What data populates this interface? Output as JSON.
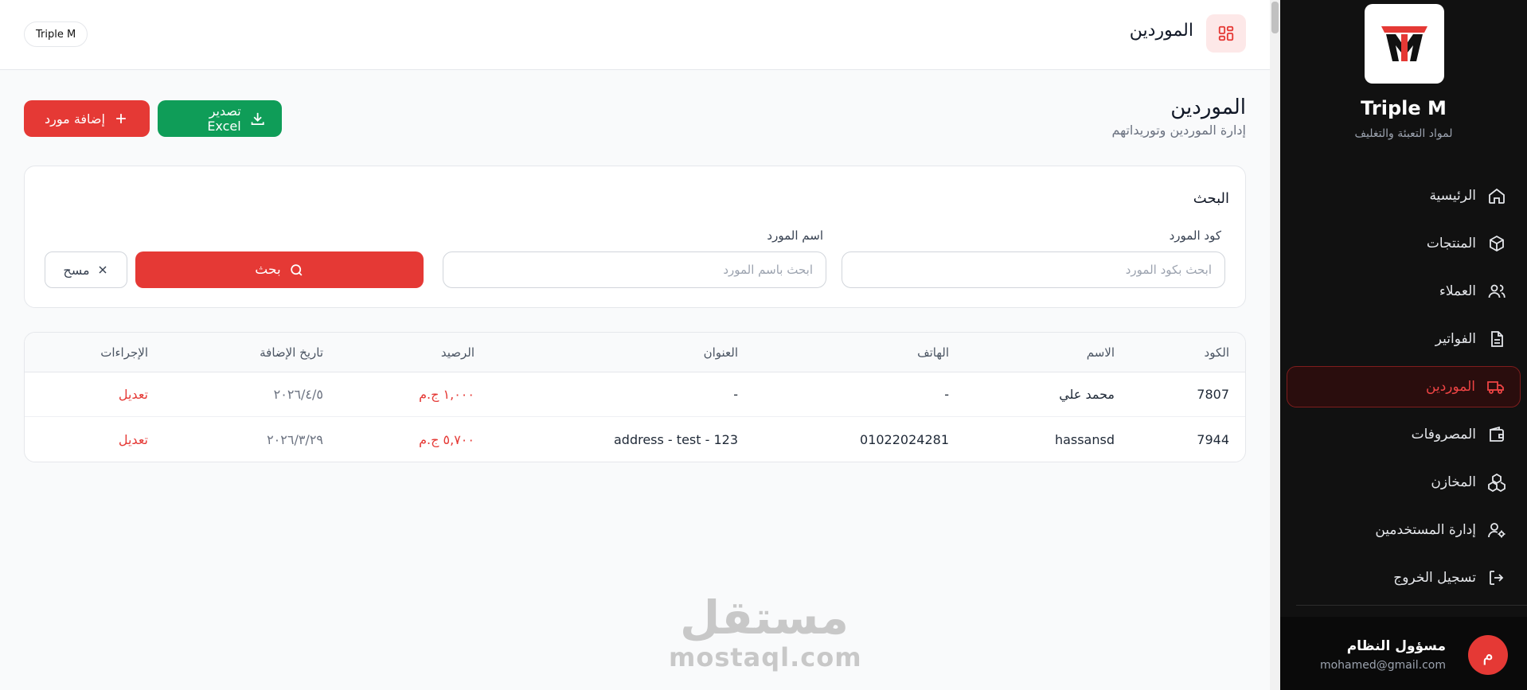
{
  "header": {
    "title": "الموردين",
    "brand_pill": "Triple M"
  },
  "page": {
    "title": "الموردين",
    "subtitle": "إدارة الموردين وتوريداتهم",
    "add_button": "إضافة مورد",
    "export_button": "تصدير Excel"
  },
  "search": {
    "title": "البحث",
    "code_label": "كود المورد",
    "code_placeholder": "ابحث بكود المورد",
    "name_label": "اسم المورد",
    "name_placeholder": "ابحث باسم المورد",
    "search_button": "بحث",
    "clear_button": "مسح"
  },
  "table": {
    "columns": {
      "code": "الكود",
      "name": "الاسم",
      "phone": "الهاتف",
      "address": "العنوان",
      "balance": "الرصيد",
      "date": "تاريخ الإضافة",
      "actions": "الإجراءات"
    },
    "rows": [
      {
        "code": "7807",
        "name": "محمد علي",
        "phone": "-",
        "address": "-",
        "balance": "١,٠٠٠ ج.م",
        "date": "٢٠٢٦/٤/٥",
        "action": "تعديل"
      },
      {
        "code": "7944",
        "name": "hassansd",
        "phone": "01022024281",
        "address": "address - test - 123",
        "balance": "٥,٧٠٠ ج.م",
        "date": "٢٠٢٦/٣/٢٩",
        "action": "تعديل"
      }
    ]
  },
  "watermark": {
    "arabic": "مستقل",
    "latin": "mostaql.com"
  },
  "sidebar": {
    "brand": "Triple M",
    "tagline": "لمواد التعبئة والتغليف",
    "items": [
      {
        "label": "الرئيسية",
        "icon": "home-icon"
      },
      {
        "label": "المنتجات",
        "icon": "box-icon"
      },
      {
        "label": "العملاء",
        "icon": "users-icon"
      },
      {
        "label": "الفواتير",
        "icon": "file-icon"
      },
      {
        "label": "الموردين",
        "icon": "truck-icon",
        "active": true
      },
      {
        "label": "المصروفات",
        "icon": "wallet-icon"
      },
      {
        "label": "المخازن",
        "icon": "boxes-icon"
      },
      {
        "label": "إدارة المستخدمين",
        "icon": "user-cog-icon"
      },
      {
        "label": "تسجيل الخروج",
        "icon": "logout-icon"
      }
    ],
    "user": {
      "avatar_letter": "م",
      "name": "مسؤول النظام",
      "email": "mohamed@gmail.com"
    }
  },
  "colors": {
    "accent": "#e53935",
    "export": "#0f9d58",
    "sidebar_bg": "#111111"
  }
}
